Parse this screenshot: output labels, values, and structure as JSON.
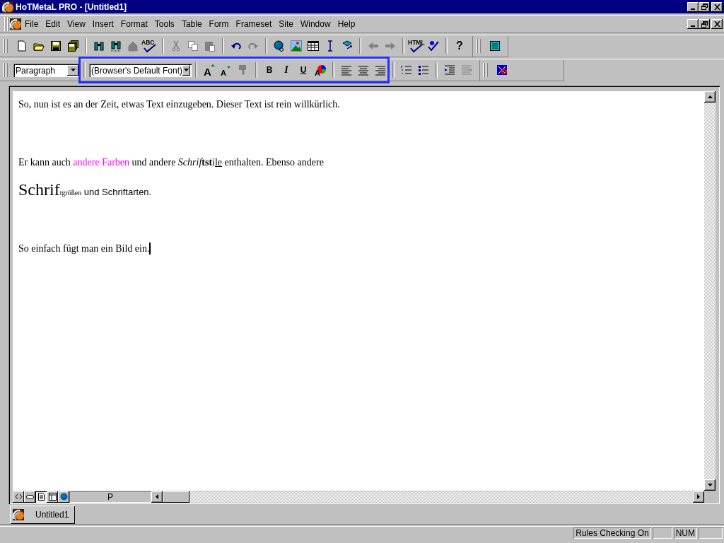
{
  "window": {
    "title": "HoTMetaL PRO - [Untitled1]"
  },
  "menu": [
    {
      "label": "File"
    },
    {
      "label": "Edit"
    },
    {
      "label": "View"
    },
    {
      "label": "Insert"
    },
    {
      "label": "Format"
    },
    {
      "label": "Tools"
    },
    {
      "label": "Table"
    },
    {
      "label": "Form"
    },
    {
      "label": "Frameset"
    },
    {
      "label": "Site"
    },
    {
      "label": "Window"
    },
    {
      "label": "Help"
    }
  ],
  "toolbar_standard": [
    {
      "kind": "new",
      "disabled": false
    },
    {
      "kind": "open",
      "disabled": false
    },
    {
      "kind": "save",
      "disabled": false
    },
    {
      "kind": "save-all",
      "disabled": false
    },
    {
      "kind": "separator"
    },
    {
      "kind": "find",
      "disabled": false
    },
    {
      "kind": "find-next",
      "disabled": false
    },
    {
      "kind": "house",
      "disabled": true
    },
    {
      "kind": "spell",
      "label": "ABC",
      "disabled": false
    },
    {
      "kind": "separator"
    },
    {
      "kind": "cut",
      "disabled": true
    },
    {
      "kind": "copy",
      "disabled": true
    },
    {
      "kind": "paste",
      "disabled": true
    },
    {
      "kind": "separator"
    },
    {
      "kind": "undo",
      "disabled": false
    },
    {
      "kind": "redo",
      "disabled": true
    },
    {
      "kind": "separator"
    },
    {
      "kind": "globe",
      "disabled": false
    },
    {
      "kind": "image",
      "disabled": false
    },
    {
      "kind": "table",
      "disabled": false
    },
    {
      "kind": "ibeam",
      "disabled": false
    },
    {
      "kind": "bucket",
      "disabled": false
    },
    {
      "kind": "separator"
    },
    {
      "kind": "back",
      "disabled": true
    },
    {
      "kind": "forward",
      "disabled": true
    },
    {
      "kind": "separator"
    },
    {
      "kind": "html-check",
      "label": "HTML",
      "disabled": false
    },
    {
      "kind": "check",
      "disabled": false
    },
    {
      "kind": "separator"
    },
    {
      "kind": "help",
      "label": "?",
      "disabled": false
    }
  ],
  "toolbar_extra": [
    {
      "kind": "screen",
      "disabled": false
    }
  ],
  "toolbar_format": [
    {
      "kind": "select",
      "value": "Paragraph"
    },
    {
      "kind": "separator"
    },
    {
      "kind": "select",
      "value": "(Browser's Default Font)"
    },
    {
      "kind": "separator"
    },
    {
      "kind": "grow",
      "label": "A",
      "disabled": false
    },
    {
      "kind": "shrink",
      "label": "A",
      "disabled": false
    },
    {
      "kind": "copy-format",
      "disabled": true
    },
    {
      "kind": "separator"
    },
    {
      "kind": "bold",
      "label": "B",
      "disabled": false
    },
    {
      "kind": "italic",
      "label": "I",
      "disabled": false
    },
    {
      "kind": "underline",
      "label": "U",
      "disabled": false
    },
    {
      "kind": "color",
      "label": "A",
      "disabled": false
    },
    {
      "kind": "separator"
    },
    {
      "kind": "align-left",
      "disabled": false
    },
    {
      "kind": "align-center",
      "disabled": false
    },
    {
      "kind": "align-right",
      "disabled": false
    },
    {
      "kind": "separator"
    },
    {
      "kind": "numbered-list",
      "disabled": false
    },
    {
      "kind": "bullet-list",
      "disabled": false
    },
    {
      "kind": "separator"
    },
    {
      "kind": "indent",
      "disabled": false
    },
    {
      "kind": "outdent",
      "disabled": true
    }
  ],
  "toolbar_format_extra": [
    {
      "kind": "special",
      "disabled": false
    }
  ],
  "document": {
    "paragraphs": [
      {
        "segments": [
          {
            "text": "So, nun ist es an der Zeit, etwas Text einzugeben. Dieser Text ist rein willkürlich.",
            "kind": "plain"
          }
        ]
      },
      {
        "segments": [
          {
            "text": "Er kann auch ",
            "kind": "plain"
          },
          {
            "text": "andere Farben",
            "kind": "colored",
            "color": "#ff00ff"
          },
          {
            "text": " und andere ",
            "kind": "plain"
          },
          {
            "text": "Schrif",
            "kind": "italic"
          },
          {
            "text": "tst",
            "kind": "bold"
          },
          {
            "text": "i",
            "kind": "plain"
          },
          {
            "text": "le",
            "kind": "underline"
          },
          {
            "text": " enthalten. Ebenso andere",
            "kind": "plain"
          }
        ]
      },
      {
        "segments": [
          {
            "text": "Schrif",
            "kind": "large"
          },
          {
            "text": "tgrößen",
            "kind": "small"
          },
          {
            "text": " und Schriftarten.",
            "kind": "sans"
          }
        ]
      },
      {
        "segments": [
          {
            "text": "So einfach fügt man ein Bild ein.",
            "kind": "plain"
          }
        ],
        "cursor": true
      }
    ]
  },
  "view_buttons": [
    {
      "kind": "tags",
      "selected": false
    },
    {
      "kind": "tags-compact",
      "selected": false
    },
    {
      "kind": "wysiwyg",
      "selected": true
    },
    {
      "kind": "layout",
      "selected": false
    },
    {
      "kind": "preview",
      "selected": false
    }
  ],
  "element_path": "P",
  "document_tabs": [
    {
      "label": "Untitled1",
      "selected": true
    }
  ],
  "status_bar": [
    {
      "text": "Rules Checking On"
    },
    {
      "text": "NUM"
    }
  ]
}
